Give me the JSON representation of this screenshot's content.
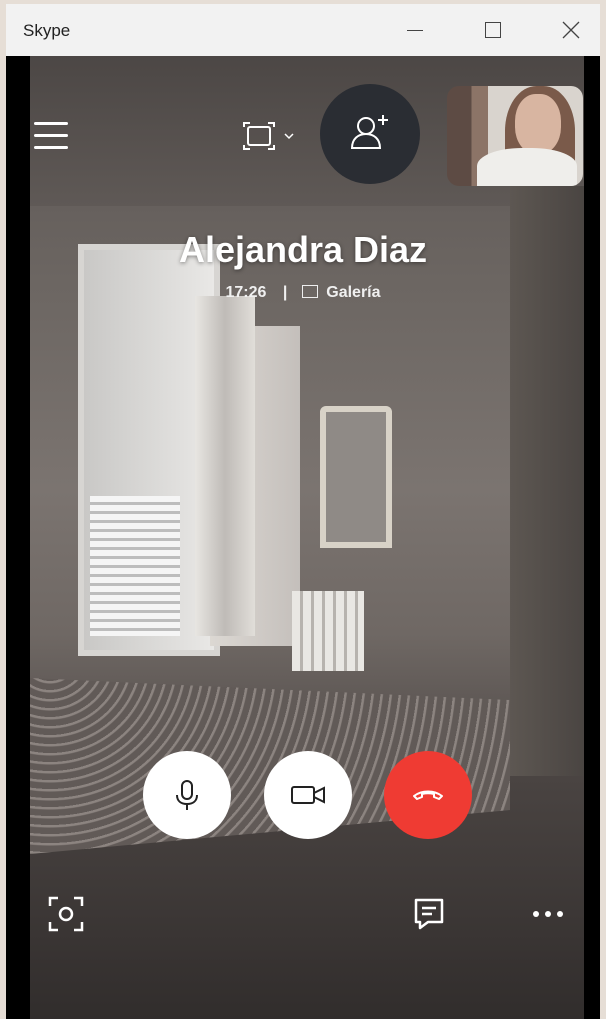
{
  "window": {
    "title": "Skype",
    "controls": {
      "minimize_icon": "minimize-icon",
      "maximize_icon": "maximize-icon",
      "close_icon": "close-icon"
    }
  },
  "call": {
    "contact_name": "Alejandra Diaz",
    "duration": "17:26",
    "separator": "|",
    "view_label": "Galería"
  },
  "toolbar": {
    "menu_icon": "hamburger-menu-icon",
    "view_icon": "view-switch-icon",
    "add_people_icon": "add-person-icon"
  },
  "controls": {
    "mic_icon": "microphone-icon",
    "video_icon": "video-camera-icon",
    "end_call_icon": "end-call-icon",
    "snapshot_icon": "snapshot-icon",
    "chat_icon": "chat-icon",
    "more_icon": "more-icon"
  },
  "colors": {
    "end_call": "#ef3b33",
    "add_button": "#2a2d33",
    "titlebar": "#f2f2f2"
  }
}
